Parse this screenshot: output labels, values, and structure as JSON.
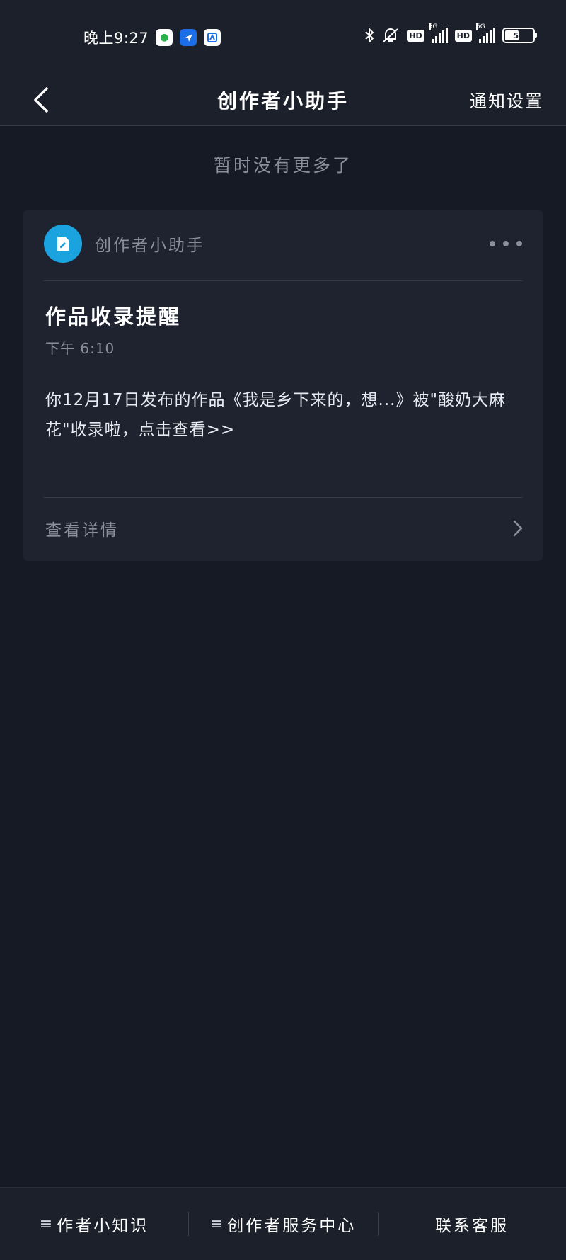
{
  "status_bar": {
    "time": "晚上9:27",
    "battery": "50",
    "battery_fraction": 0.5,
    "network_label": "5G",
    "hd_label": "HD"
  },
  "nav": {
    "title": "创作者小助手",
    "action": "通知设置"
  },
  "feed": {
    "no_more_text": "暂时没有更多了"
  },
  "message": {
    "sender": "创作者小助手",
    "title": "作品收录提醒",
    "time": "下午 6:10",
    "body": "你12月17日发布的作品《我是乡下来的，想...》被\"酸奶大麻花\"收录啦，点击查看>>",
    "detail_label": "查看详情"
  },
  "bottom_bar": {
    "items": [
      {
        "label": "作者小知识",
        "has_menu": true
      },
      {
        "label": "创作者服务中心",
        "has_menu": true
      },
      {
        "label": "联系客服",
        "has_menu": false
      }
    ]
  },
  "colors": {
    "background": "#161a24",
    "card": "#1f2330",
    "accent": "#1ba3e0",
    "muted_text": "#8a8f9c"
  }
}
